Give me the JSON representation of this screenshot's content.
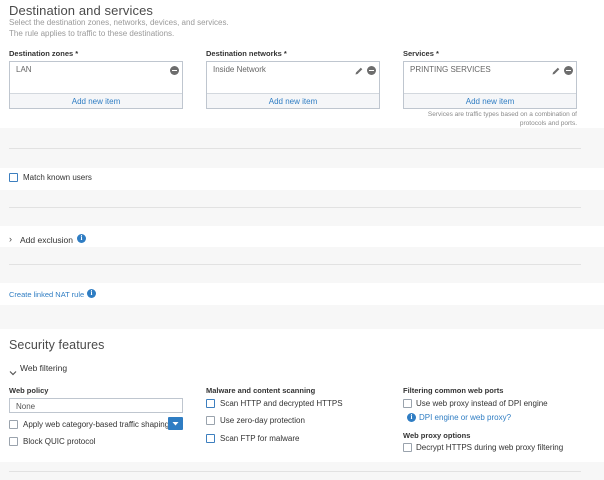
{
  "destination": {
    "title": "Destination and services",
    "subtitle_1": "Select the destination zones, networks, devices, and services.",
    "subtitle_2": "The rule applies to traffic to these destinations.",
    "zones": {
      "label": "Destination zones *",
      "value": "LAN",
      "add": "Add new item"
    },
    "networks": {
      "label": "Destination networks *",
      "value": "Inside Network",
      "add": "Add new item"
    },
    "services": {
      "label": "Services *",
      "value": "PRINTING SERVICES",
      "add": "Add new item",
      "hint_1": "Services are traffic types based on a combination of",
      "hint_2": "protocols and ports."
    }
  },
  "match_users": {
    "label": "Match known users"
  },
  "exclusion": {
    "label": "Add exclusion"
  },
  "nat": {
    "label": "Create linked NAT rule"
  },
  "security": {
    "title": "Security features",
    "web_filtering": "Web filtering",
    "web_policy": {
      "label": "Web policy",
      "value": "None"
    },
    "apply_traffic_shaping": "Apply web category-based traffic shaping",
    "block_quic": "Block QUIC protocol",
    "malware": {
      "label": "Malware and content scanning",
      "scan_http": "Scan HTTP and decrypted HTTPS",
      "zero_day": "Use zero-day protection",
      "scan_ftp": "Scan FTP for malware"
    },
    "filtering_ports": {
      "label": "Filtering common web ports",
      "use_proxy": "Use web proxy instead of DPI engine",
      "dpi_link": "DPI engine or web proxy?"
    },
    "proxy_options": {
      "label": "Web proxy options",
      "decrypt_https": "Decrypt HTTPS during web proxy filtering"
    }
  }
}
